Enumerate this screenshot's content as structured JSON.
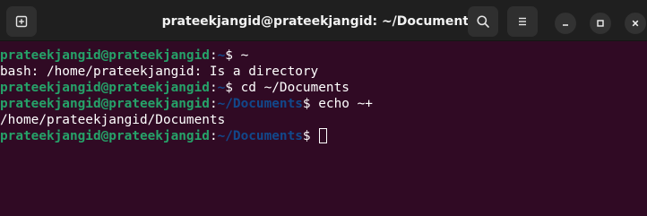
{
  "window": {
    "title": "prateekjangid@prateekjangid: ~/Documents"
  },
  "titlebar": {
    "new_tab_icon": "new-tab-icon",
    "search_icon": "search-icon",
    "menu_icon": "hamburger-menu-icon",
    "minimize_icon": "minimize-icon",
    "maximize_icon": "maximize-icon",
    "close_icon": "close-icon"
  },
  "colors": {
    "background": "#300a24",
    "user_host": "#26a269",
    "path": "#12488b",
    "text": "#ffffff"
  },
  "terminal": {
    "lines": [
      {
        "prompt_user": "prateekjangid@prateekjangid",
        "sep": ":",
        "path": "~",
        "dollar": "$ ",
        "command": "~"
      },
      {
        "output": "bash: /home/prateekjangid: Is a directory"
      },
      {
        "prompt_user": "prateekjangid@prateekjangid",
        "sep": ":",
        "path": "~",
        "dollar": "$ ",
        "command": "cd ~/Documents"
      },
      {
        "prompt_user": "prateekjangid@prateekjangid",
        "sep": ":",
        "path": "~/Documents",
        "dollar": "$ ",
        "command": "echo ~+"
      },
      {
        "output": "/home/prateekjangid/Documents"
      },
      {
        "prompt_user": "prateekjangid@prateekjangid",
        "sep": ":",
        "path": "~/Documents",
        "dollar": "$ ",
        "command": ""
      }
    ]
  }
}
